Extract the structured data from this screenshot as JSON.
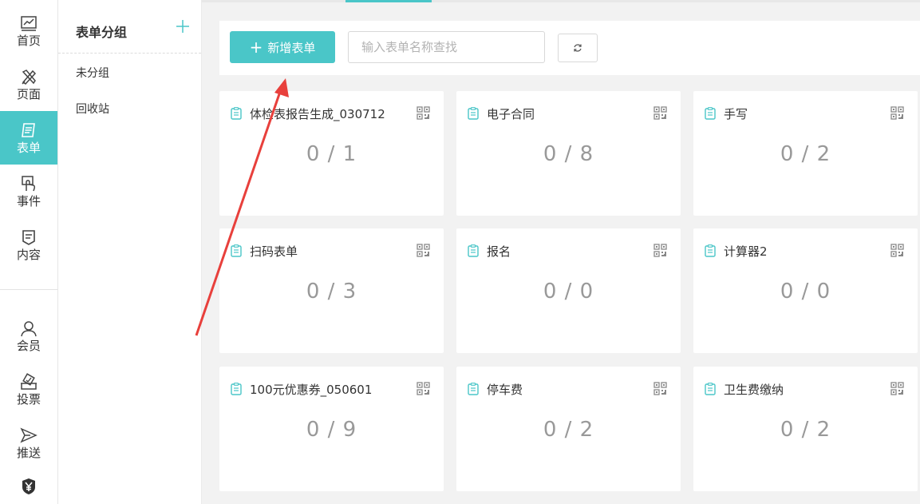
{
  "nav": {
    "items": [
      {
        "label": "首页",
        "icon": "chart-icon"
      },
      {
        "label": "页面",
        "icon": "design-tools-icon"
      },
      {
        "label": "表单",
        "icon": "form-icon"
      },
      {
        "label": "事件",
        "icon": "touch-hand-icon"
      },
      {
        "label": "内容",
        "icon": "content-icon"
      },
      {
        "label": "会员",
        "icon": "user-icon"
      },
      {
        "label": "投票",
        "icon": "vote-icon"
      },
      {
        "label": "推送",
        "icon": "send-icon"
      }
    ],
    "active": "表单",
    "partial_icon": "yen-shield-icon"
  },
  "groups": {
    "title": "表单分组",
    "items": [
      "未分组",
      "回收站"
    ]
  },
  "toolbar": {
    "new_button_label": "新增表单",
    "search_placeholder": "输入表单名称查找"
  },
  "forms": [
    {
      "title": "体检表报告生成_030712",
      "count": "0 / 1"
    },
    {
      "title": "电子合同",
      "count": "0 / 8"
    },
    {
      "title": "手写",
      "count": "0 / 2"
    },
    {
      "title": "扫码表单",
      "count": "0 / 3"
    },
    {
      "title": "报名",
      "count": "0 / 0"
    },
    {
      "title": "计算器2",
      "count": "0 / 0"
    },
    {
      "title": "100元优惠券_050601",
      "count": "0 / 9"
    },
    {
      "title": "停车费",
      "count": "0 / 2"
    },
    {
      "title": "卫生费缴纳",
      "count": "0 / 2"
    }
  ],
  "colors": {
    "accent": "#4ac6c8",
    "annotation_arrow": "#e8403c"
  }
}
